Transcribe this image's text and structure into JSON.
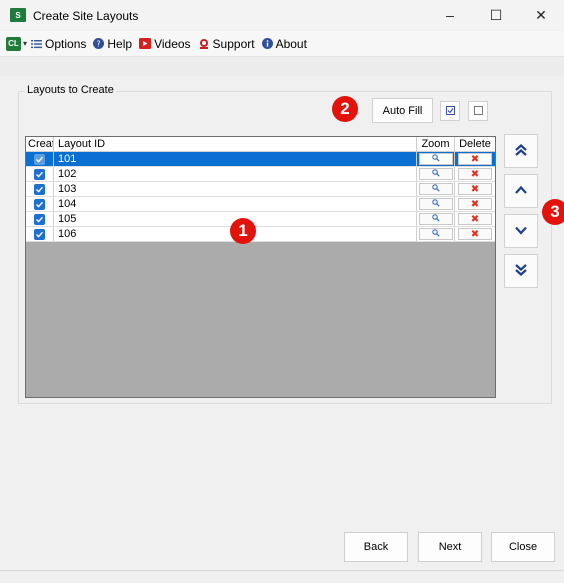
{
  "window": {
    "title": "Create Site Layouts",
    "app_icon_text": "S",
    "controls": {
      "minimize": "–",
      "maximize": "☐",
      "close": "✕"
    }
  },
  "menu": {
    "logo_text": "CL",
    "caret": "▾",
    "items": [
      {
        "label": "Options",
        "icon": "list-icon"
      },
      {
        "label": "Help",
        "icon": "help-icon"
      },
      {
        "label": "Videos",
        "icon": "video-icon"
      },
      {
        "label": "Support",
        "icon": "support-icon"
      },
      {
        "label": "About",
        "icon": "info-icon"
      }
    ]
  },
  "group": {
    "title": "Layouts to Create",
    "auto_fill_label": "Auto Fill"
  },
  "grid": {
    "headers": {
      "create": "Create",
      "layout_id": "Layout ID",
      "zoom": "Zoom",
      "delete": "Delete"
    },
    "rows": [
      {
        "id": "101",
        "checked": true,
        "selected": true
      },
      {
        "id": "102",
        "checked": true,
        "selected": false
      },
      {
        "id": "103",
        "checked": true,
        "selected": false
      },
      {
        "id": "104",
        "checked": true,
        "selected": false
      },
      {
        "id": "105",
        "checked": true,
        "selected": false
      },
      {
        "id": "106",
        "checked": true,
        "selected": false
      }
    ]
  },
  "callouts": {
    "one": "1",
    "two": "2",
    "three": "3"
  },
  "footer": {
    "back": "Back",
    "next": "Next",
    "close": "Close"
  },
  "colors": {
    "accent": "#0a6fd2",
    "callout": "#e3120b",
    "brand_green": "#1e7b3a",
    "nav_arrow": "#1d3f8c"
  }
}
